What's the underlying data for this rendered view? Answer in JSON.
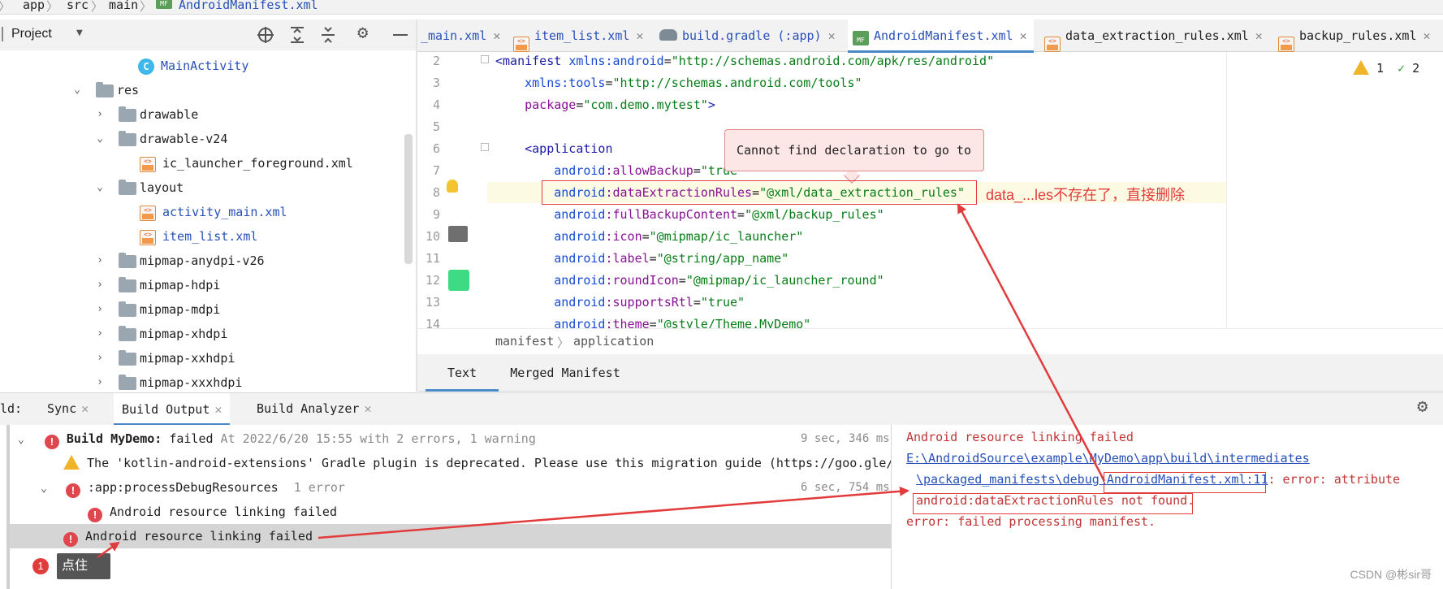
{
  "breadcrumb": [
    "app",
    "src",
    "main",
    "AndroidManifest.xml"
  ],
  "project_panel": {
    "title": "Project",
    "tree": [
      {
        "label": "MainActivity",
        "type": "class",
        "expanded": null
      },
      {
        "label": "res",
        "type": "res-folder",
        "expanded": true
      },
      {
        "label": "drawable",
        "type": "folder",
        "expanded": false
      },
      {
        "label": "drawable-v24",
        "type": "folder",
        "expanded": true
      },
      {
        "label": "ic_launcher_foreground.xml",
        "type": "xml",
        "expanded": null
      },
      {
        "label": "layout",
        "type": "folder",
        "expanded": true
      },
      {
        "label": "activity_main.xml",
        "type": "xml-blue",
        "expanded": null
      },
      {
        "label": "item_list.xml",
        "type": "xml-blue",
        "expanded": null
      },
      {
        "label": "mipmap-anydpi-v26",
        "type": "folder",
        "expanded": false
      },
      {
        "label": "mipmap-hdpi",
        "type": "folder",
        "expanded": false
      },
      {
        "label": "mipmap-mdpi",
        "type": "folder",
        "expanded": false
      },
      {
        "label": "mipmap-xhdpi",
        "type": "folder",
        "expanded": false
      },
      {
        "label": "mipmap-xxhdpi",
        "type": "folder",
        "expanded": false
      },
      {
        "label": "mipmap-xxxhdpi",
        "type": "folder",
        "expanded": false
      }
    ]
  },
  "editor_tabs": [
    {
      "label": "_main.xml",
      "icon": "none",
      "active": false
    },
    {
      "label": "item_list.xml",
      "icon": "xml",
      "active": false
    },
    {
      "label": "build.gradle (:app)",
      "icon": "gradle",
      "active": false
    },
    {
      "label": "AndroidManifest.xml",
      "icon": "manifest",
      "active": true
    },
    {
      "label": "data_extraction_rules.xml",
      "icon": "xml",
      "active": false
    },
    {
      "label": "backup_rules.xml",
      "icon": "xml",
      "active": false
    }
  ],
  "inspections": {
    "warnings": "1",
    "weak_warnings": "2"
  },
  "code": {
    "line_numbers": [
      "2",
      "3",
      "4",
      "5",
      "6",
      "7",
      "8",
      "9",
      "10",
      "11",
      "12",
      "13",
      "14"
    ],
    "lines": [
      {
        "indent": "",
        "parts": [
          [
            "tagc",
            "<manifest "
          ],
          [
            "ns",
            "xmlns:android"
          ],
          [
            "plain",
            "="
          ],
          [
            "val",
            "\"http://schemas.android.com/apk/res/android\""
          ]
        ]
      },
      {
        "indent": "    ",
        "parts": [
          [
            "ns",
            "xmlns:tools"
          ],
          [
            "plain",
            "="
          ],
          [
            "val",
            "\"http://schemas.android.com/tools\""
          ]
        ]
      },
      {
        "indent": "    ",
        "parts": [
          [
            "attr",
            "package"
          ],
          [
            "plain",
            "="
          ],
          [
            "val",
            "\"com.demo.mytest\""
          ],
          [
            "tagc",
            ">"
          ]
        ]
      },
      {
        "indent": "",
        "parts": []
      },
      {
        "indent": "    ",
        "parts": [
          [
            "tagc",
            "<application"
          ]
        ]
      },
      {
        "indent": "        ",
        "parts": [
          [
            "ns",
            "android"
          ],
          [
            "attr",
            ":allowBackup"
          ],
          [
            "plain",
            "="
          ],
          [
            "val",
            "\"true\""
          ]
        ]
      },
      {
        "indent": "        ",
        "parts": [
          [
            "ns",
            "android"
          ],
          [
            "attr",
            ":dataExtractionRules"
          ],
          [
            "plain",
            "="
          ],
          [
            "val",
            "\"@xml/data_extraction_rules\""
          ]
        ]
      },
      {
        "indent": "        ",
        "parts": [
          [
            "ns",
            "android"
          ],
          [
            "attr",
            ":fullBackupContent"
          ],
          [
            "plain",
            "="
          ],
          [
            "val",
            "\"@xml/backup_rules\""
          ]
        ]
      },
      {
        "indent": "        ",
        "parts": [
          [
            "ns",
            "android"
          ],
          [
            "attr",
            ":icon"
          ],
          [
            "plain",
            "="
          ],
          [
            "val",
            "\"@mipmap/ic_launcher\""
          ]
        ]
      },
      {
        "indent": "        ",
        "parts": [
          [
            "ns",
            "android"
          ],
          [
            "attr",
            ":label"
          ],
          [
            "plain",
            "="
          ],
          [
            "val",
            "\"@string/app_name\""
          ]
        ]
      },
      {
        "indent": "        ",
        "parts": [
          [
            "ns",
            "android"
          ],
          [
            "attr",
            ":roundIcon"
          ],
          [
            "plain",
            "="
          ],
          [
            "val",
            "\"@mipmap/ic_launcher_round\""
          ]
        ]
      },
      {
        "indent": "        ",
        "parts": [
          [
            "ns",
            "android"
          ],
          [
            "attr",
            ":supportsRtl"
          ],
          [
            "plain",
            "="
          ],
          [
            "val",
            "\"true\""
          ]
        ]
      },
      {
        "indent": "        ",
        "parts": [
          [
            "ns",
            "android"
          ],
          [
            "attr",
            ":theme"
          ],
          [
            "plain",
            "="
          ],
          [
            "val",
            "\"@style/Theme.MyDemo\""
          ]
        ]
      }
    ]
  },
  "tooltip": "Cannot find declaration to go to",
  "annotation_text": "data_...les不存在了，直接删除",
  "editor_breadcrumb": [
    "manifest",
    "application"
  ],
  "editor_bottom_tabs": [
    {
      "label": "Text",
      "active": true
    },
    {
      "label": "Merged Manifest",
      "active": false
    }
  ],
  "build_panel": {
    "prefix": "ld:",
    "tabs": [
      {
        "label": "Sync",
        "active": false
      },
      {
        "label": "Build Output",
        "active": true
      },
      {
        "label": "Build Analyzer",
        "active": false
      }
    ],
    "tree": {
      "root_title": "Build MyDemo:",
      "root_status": "failed",
      "root_detail": "At 2022/6/20 15:55 with 2 errors, 1 warning",
      "root_time": "9 sec, 346 ms",
      "warning": "The 'kotlin-android-extensions' Gradle plugin is deprecated. Please use this migration guide (https://goo.gle/",
      "task": ":app:processDebugResources",
      "task_count": "1 error",
      "task_time": "6 sec, 754 ms",
      "task_child": "Android resource linking failed",
      "selected": "Android resource linking failed"
    },
    "detail": {
      "line1": "Android resource linking failed",
      "path1": "E:\\AndroidSource\\example\\MyDemo\\app\\build\\intermediates",
      "path2": "\\packaged_manifests\\debug\\",
      "path_link": "AndroidManifest.xml:11",
      "path_rest": ": error: attribute",
      "line3": "android:dataExtractionRules not found.",
      "line4": "error: failed processing manifest."
    }
  },
  "callout": {
    "number": "1",
    "label": "点住"
  },
  "watermark": "CSDN @彬sir哥",
  "colors": {
    "accent": "#4a88c7",
    "error": "#e0464e",
    "annotation": "#e23b3b"
  }
}
